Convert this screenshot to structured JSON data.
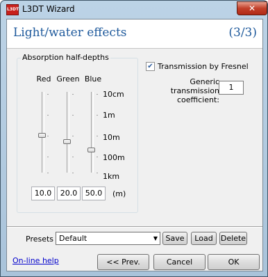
{
  "window": {
    "app_icon_text": "L3DT",
    "title": "L3DT Wizard",
    "close_glyph": "✕"
  },
  "header": {
    "title": "Light/water effects",
    "step": "(3/3)"
  },
  "absorption": {
    "group_label": "Absorption half-depths",
    "columns": [
      "Red",
      "Green",
      "Blue"
    ],
    "scale_labels": [
      "10cm",
      "1m",
      "10m",
      "100m",
      "1km"
    ],
    "values": [
      "10.0",
      "20.0",
      "50.0"
    ],
    "unit": "(m)"
  },
  "fresnel": {
    "label": "Transmission by Fresnel",
    "checked": true,
    "check_glyph": "✔"
  },
  "coefficient": {
    "label_line1": "Generic transmission",
    "label_line2": "coefficient:",
    "value": "1"
  },
  "presets": {
    "label": "Presets",
    "selected": "Default",
    "arrow_glyph": "▼",
    "save": "Save",
    "load": "Load",
    "delete": "Delete"
  },
  "footer": {
    "help_link": "On-line help",
    "prev": "<< Prev.",
    "cancel": "Cancel",
    "ok": "OK"
  }
}
